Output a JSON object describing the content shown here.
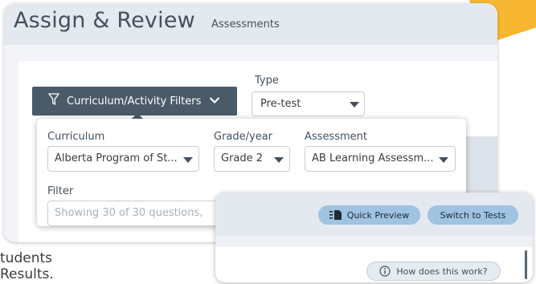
{
  "header": {
    "title": "Assign & Review",
    "subtitle": "Assessments"
  },
  "filters": {
    "toggle_label": "Curriculum/Activity Filters",
    "type_label": "Type",
    "type_value": "Pre-test",
    "curriculum_label": "Curriculum",
    "curriculum_value": "Alberta Program of St...",
    "grade_label": "Grade/year",
    "grade_value": "Grade 2",
    "assessment_label": "Assessment",
    "assessment_value": "AB Learning Assessm...",
    "filter_label": "Filter",
    "filter_placeholder": "Showing 30 of 30 questions,"
  },
  "background_text": {
    "line1": "tudents",
    "line2": "Results."
  },
  "popup": {
    "quick_preview": "Quick Preview",
    "switch_to_tests": "Switch to Tests",
    "how_does_this_work": "How does this work?"
  }
}
